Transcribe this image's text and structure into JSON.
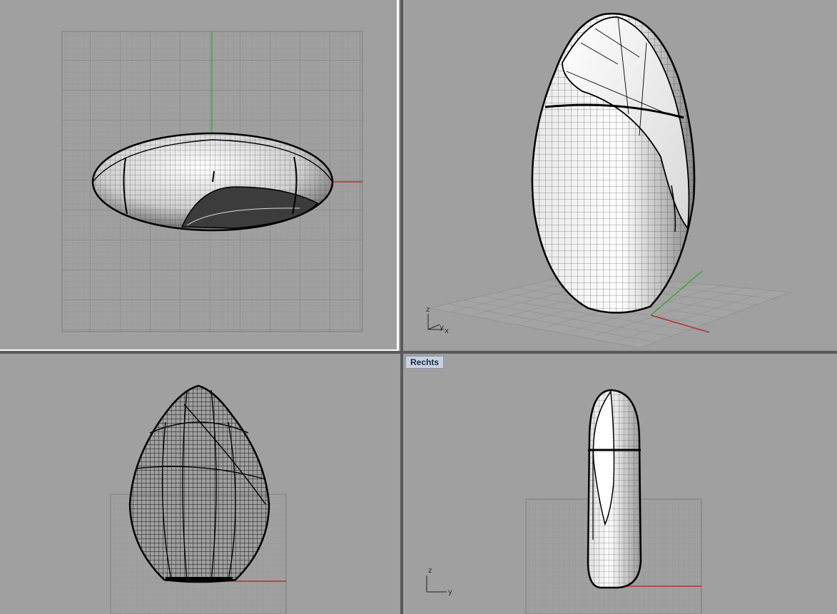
{
  "viewports": {
    "top": {
      "title": ""
    },
    "perspective": {
      "title": "",
      "axis_z": "z",
      "axis_y": "y",
      "axis_x": "x"
    },
    "front": {
      "title": ""
    },
    "right": {
      "title": "Rechts",
      "axis_z": "z",
      "axis_y": "y"
    }
  },
  "colors": {
    "viewport_bg": "#a0a0a0",
    "grid_minor": "#8f8f8f",
    "grid_major": "#7c7c7c",
    "axis_x": "#b43030",
    "axis_y": "#3aa83a",
    "active_border": "#ffffff",
    "title_bg": "#c8d2e0"
  },
  "icons": [
    "axis-widget-icon"
  ]
}
